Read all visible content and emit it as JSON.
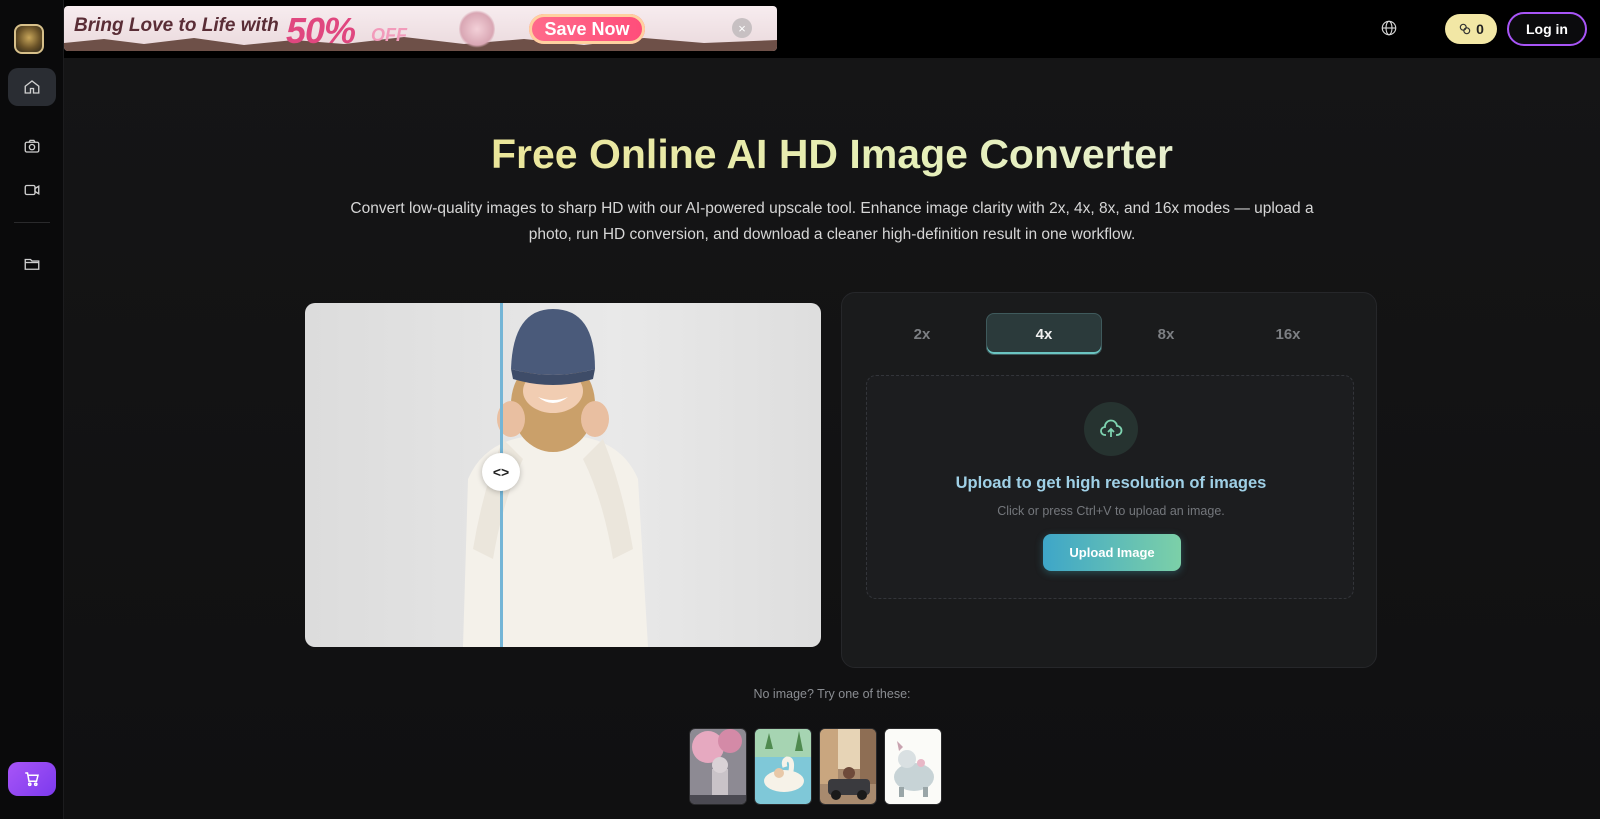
{
  "banner": {
    "text": "Bring Love to Life with",
    "percent": "50%",
    "off": "OFF",
    "cta": "Save Now",
    "close": "×"
  },
  "topbar": {
    "credits": "0",
    "login": "Log in"
  },
  "sidebar": {
    "items": [
      "home-icon",
      "camera-icon",
      "video-icon",
      "folder-icon"
    ],
    "active": "home-icon"
  },
  "hero": {
    "title": "Free Online AI HD Image Converter",
    "subtitle": "Convert low-quality images to sharp HD with our AI-powered upscale tool. Enhance image clarity with 2x, 4x, 8x, and 16x modes — upload a photo, run HD conversion, and download a cleaner high-definition result in one workflow."
  },
  "comparison": {
    "handle": "<>"
  },
  "panel": {
    "tabs": [
      "2x",
      "4x",
      "8x",
      "16x"
    ],
    "active_tab": "4x",
    "upload_title": "Upload to get high resolution of images",
    "upload_hint": "Click or press Ctrl+V to upload an image.",
    "upload_button": "Upload Image"
  },
  "samples": {
    "label": "No image? Try one of these:",
    "count": 4
  },
  "colors": {
    "accent_purple": "#a855f7",
    "credits_bg": "#f2e7a5",
    "upload_gradient_start": "#3ea6c8",
    "upload_gradient_end": "#7cd0a8"
  }
}
